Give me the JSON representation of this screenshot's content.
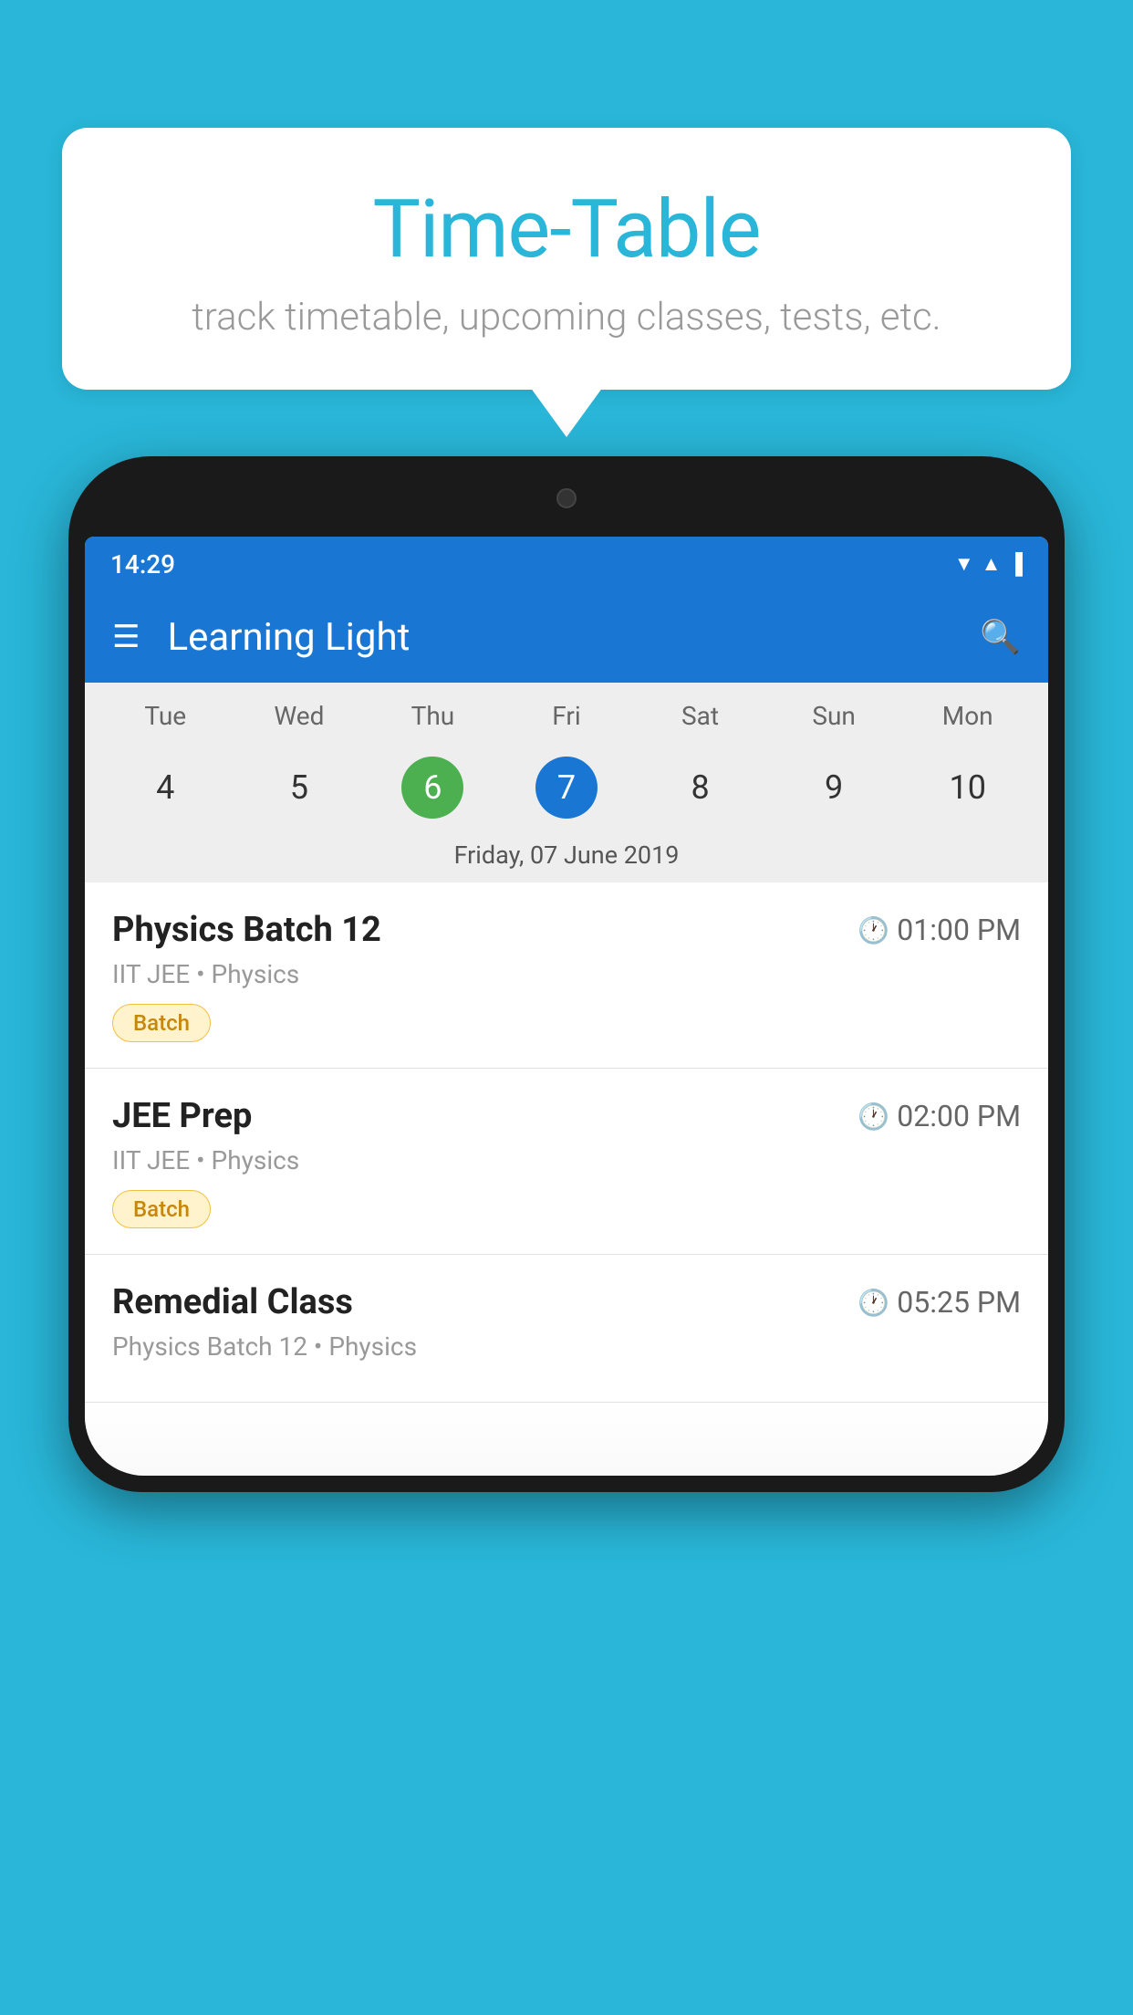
{
  "background_color": "#29b6d8",
  "bubble": {
    "title": "Time-Table",
    "subtitle": "track timetable, upcoming classes, tests, etc."
  },
  "phone": {
    "status_bar": {
      "time": "14:29",
      "icons": [
        "wifi",
        "signal",
        "battery"
      ]
    },
    "app_bar": {
      "title": "Learning Light"
    },
    "calendar": {
      "days": [
        "Tue",
        "Wed",
        "Thu",
        "Fri",
        "Sat",
        "Sun",
        "Mon"
      ],
      "dates": [
        {
          "num": "4",
          "state": "normal"
        },
        {
          "num": "5",
          "state": "normal"
        },
        {
          "num": "6",
          "state": "today"
        },
        {
          "num": "7",
          "state": "selected"
        },
        {
          "num": "8",
          "state": "normal"
        },
        {
          "num": "9",
          "state": "normal"
        },
        {
          "num": "10",
          "state": "normal"
        }
      ],
      "selected_date_label": "Friday, 07 June 2019"
    },
    "schedule": [
      {
        "name": "Physics Batch 12",
        "time": "01:00 PM",
        "meta": "IIT JEE • Physics",
        "badge": "Batch"
      },
      {
        "name": "JEE Prep",
        "time": "02:00 PM",
        "meta": "IIT JEE • Physics",
        "badge": "Batch"
      },
      {
        "name": "Remedial Class",
        "time": "05:25 PM",
        "meta": "Physics Batch 12 • Physics",
        "badge": null
      }
    ]
  }
}
